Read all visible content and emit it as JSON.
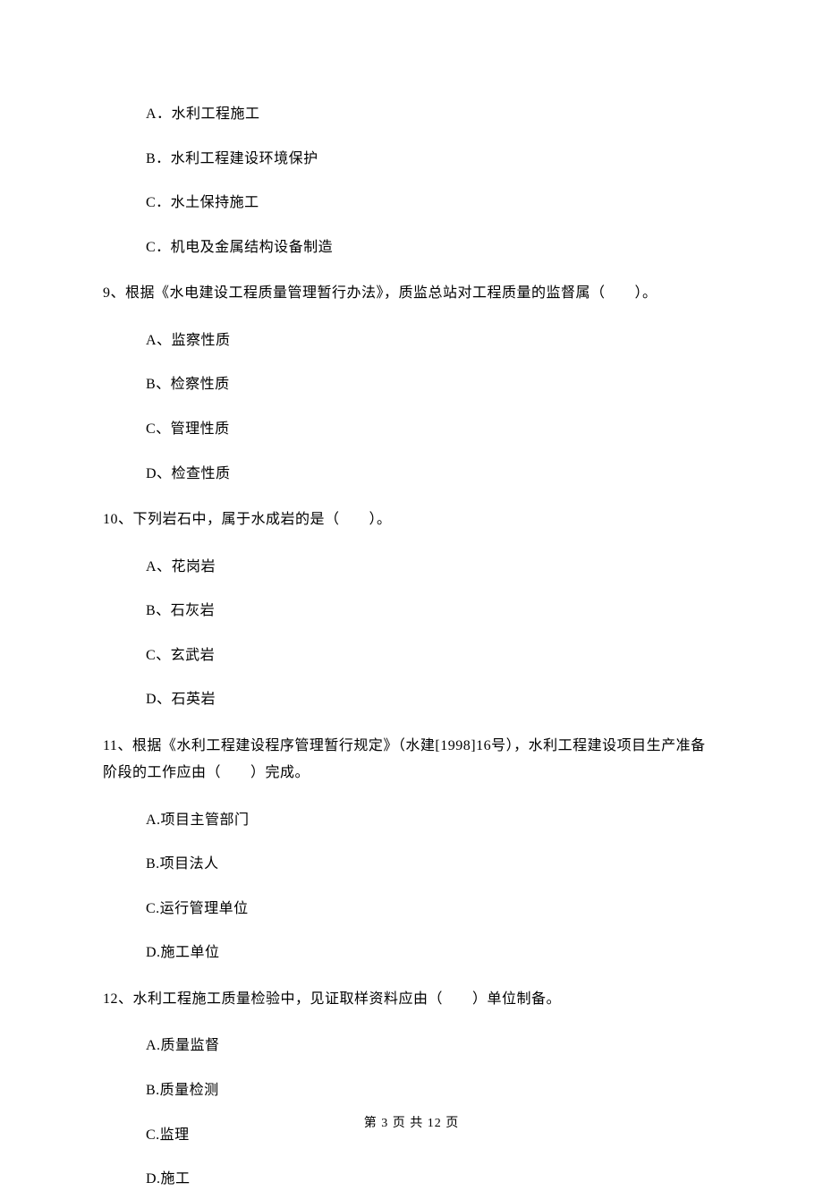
{
  "q8_options": {
    "a": "A．水利工程施工",
    "b": "B．水利工程建设环境保护",
    "c": "C．水土保持施工",
    "c2": "C．机电及金属结构设备制造"
  },
  "q9": {
    "stem": "9、根据《水电建设工程质量管理暂行办法》，质监总站对工程质量的监督属（　　）。",
    "a": "A、监察性质",
    "b": "B、检察性质",
    "c": "C、管理性质",
    "d": "D、检查性质"
  },
  "q10": {
    "stem": "10、下列岩石中，属于水成岩的是（　　）。",
    "a": "A、花岗岩",
    "b": "B、石灰岩",
    "c": "C、玄武岩",
    "d": "D、石英岩"
  },
  "q11": {
    "stem": "11、根据《水利工程建设程序管理暂行规定》（水建[1998]16号），水利工程建设项目生产准备 阶段的工作应由（　　）完成。",
    "a": "A.项目主管部门",
    "b": "B.项目法人",
    "c": "C.运行管理单位",
    "d": "D.施工单位"
  },
  "q12": {
    "stem": "12、水利工程施工质量检验中，见证取样资料应由（　　）单位制备。",
    "a": "A.质量监督",
    "b": "B.质量检测",
    "c": "C.监理",
    "d": "D.施工"
  },
  "footer": "第 3 页 共 12 页"
}
